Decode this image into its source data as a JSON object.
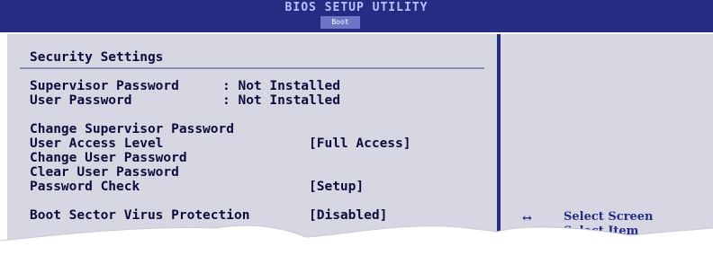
{
  "title": "BIOS SETUP UTILITY",
  "active_tab": "Boot",
  "section_title": "Security Settings",
  "status": [
    {
      "label": "Supervisor Password",
      "value": ": Not Installed"
    },
    {
      "label": "User Password",
      "value": ": Not Installed"
    }
  ],
  "options": [
    {
      "label": "Change Supervisor Password",
      "value": ""
    },
    {
      "label": "User Access Level",
      "value": "[Full Access]"
    },
    {
      "label": "Change User Password",
      "value": ""
    },
    {
      "label": "Clear User Password",
      "value": ""
    },
    {
      "label": "Password Check",
      "value": "[Setup]"
    },
    {
      "label": "Boot Sector Virus Protection",
      "value": "[Disabled]"
    }
  ],
  "help": [
    {
      "key": "↔",
      "action": "Select Screen"
    },
    {
      "key": "↕",
      "action": "Select Item"
    }
  ],
  "colors": {
    "title_bar": "#252d82",
    "panel": "#d6d7e3",
    "text": "#0c0c3a",
    "highlight_tab": "#6d76c6"
  }
}
